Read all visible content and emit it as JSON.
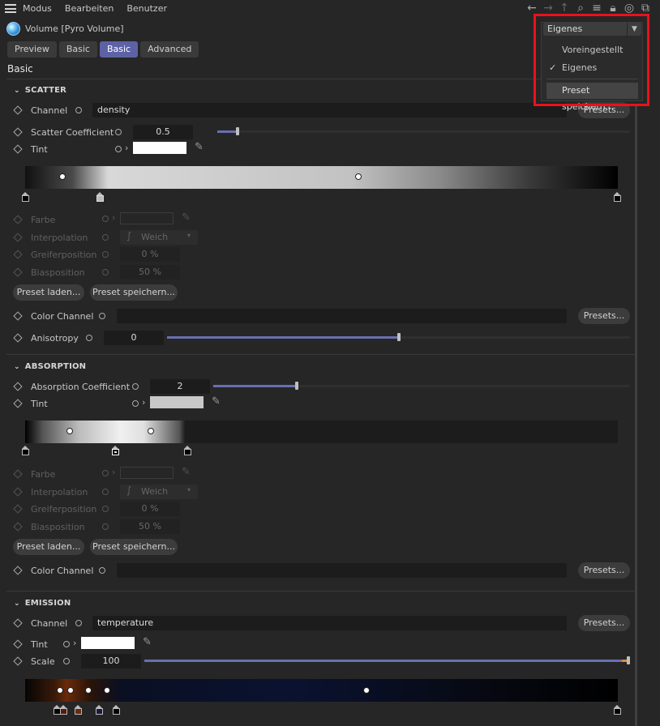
{
  "menubar": {
    "items": [
      "Modus",
      "Bearbeiten",
      "Benutzer"
    ]
  },
  "toolbar": {
    "icons": [
      "back-arrow-icon",
      "forward-arrow-icon",
      "up-arrow-icon",
      "search-icon",
      "filter-icon",
      "lock-icon",
      "target-icon",
      "new-window-icon"
    ]
  },
  "object": {
    "title": "Volume [Pyro Volume]"
  },
  "tabs": [
    "Preview",
    "Basic",
    "Basic",
    "Advanced"
  ],
  "active_tab_index": 2,
  "section_title": "Basic",
  "preset_dropdown": {
    "selected": "Eigenes",
    "options": [
      "Voreingestellt",
      "Eigenes"
    ],
    "checked": "Eigenes",
    "action": "Preset speichern..."
  },
  "scatter": {
    "header": "SCATTER",
    "channel_label": "Channel",
    "channel_value": "density",
    "presets_label": "Presets...",
    "coef_label": "Scatter Coefficient",
    "coef_value": "0.5",
    "coef_fraction": 0.05,
    "tint_label": "Tint",
    "tint_color": "#ffffff",
    "farbe_label": "Farbe",
    "interp_label": "Interpolation",
    "interp_value": "Weich",
    "greif_label": "Greiferposition",
    "greif_value": "0 %",
    "bias_label": "Biasposition",
    "bias_value": "50 %",
    "preset_load": "Preset laden...",
    "preset_save": "Preset speichern...",
    "color_channel_label": "Color Channel",
    "color_presets": "Presets...",
    "aniso_label": "Anisotropy",
    "aniso_value": "0",
    "aniso_fraction": 0.5
  },
  "absorption": {
    "header": "ABSORPTION",
    "coef_label": "Absorption Coefficient",
    "coef_value": "2",
    "coef_fraction": 0.2,
    "tint_label": "Tint",
    "tint_color": "#c8c8c8",
    "farbe_label": "Farbe",
    "interp_label": "Interpolation",
    "interp_value": "Weich",
    "greif_label": "Greiferposition",
    "greif_value": "0 %",
    "bias_label": "Biasposition",
    "bias_value": "50 %",
    "preset_load": "Preset laden...",
    "preset_save": "Preset speichern...",
    "color_channel_label": "Color Channel",
    "color_presets": "Presets..."
  },
  "emission": {
    "header": "EMISSION",
    "channel_label": "Channel",
    "channel_value": "temperature",
    "presets_label": "Presets...",
    "tint_label": "Tint",
    "tint_color": "#ffffff",
    "scale_label": "Scale",
    "scale_value": "100",
    "scale_fraction": 1.0
  },
  "colors": {
    "accent": "#5d62a5",
    "highlight": "#e8121b"
  }
}
